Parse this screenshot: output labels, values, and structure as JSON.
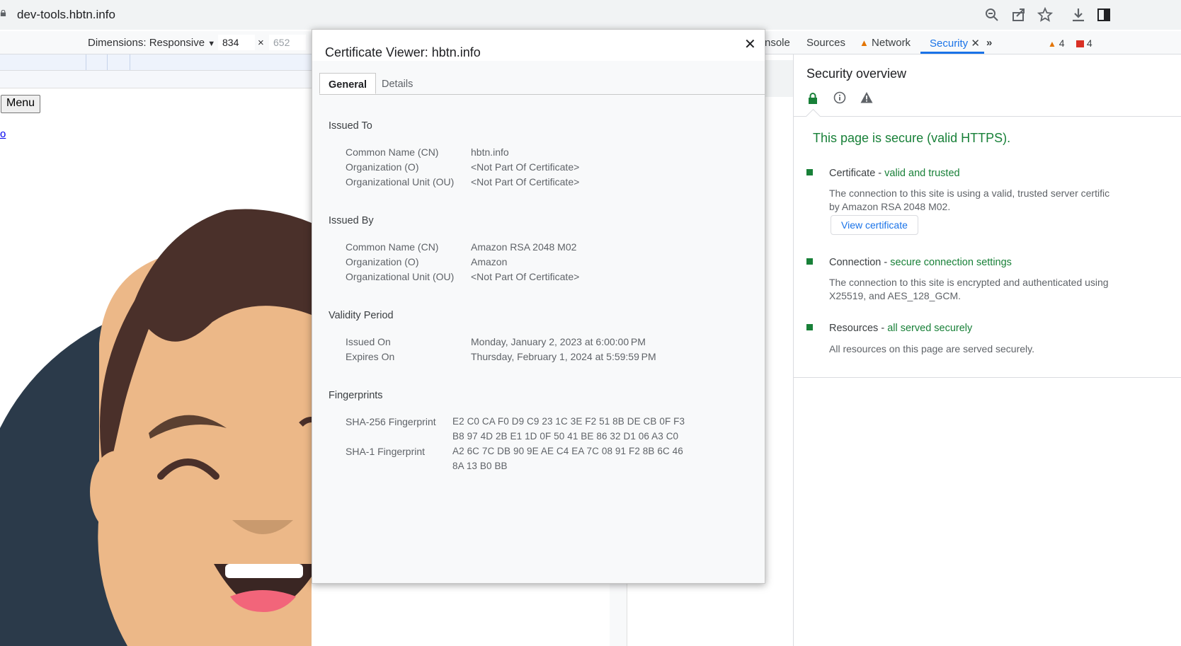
{
  "browser": {
    "url": "dev-tools.hbtn.info"
  },
  "device_toolbar": {
    "dimensions_label": "Dimensions: Responsive",
    "width": "834",
    "height": "652",
    "times": "×"
  },
  "page": {
    "menu_label": "Menu",
    "link_text": "o"
  },
  "devtools": {
    "tabs": [
      "nsole",
      "Sources",
      "Network",
      "Security"
    ],
    "more_glyph": "»",
    "warnings": "4",
    "errors": "4"
  },
  "security": {
    "title": "Security overview",
    "headline": "This page is secure (valid HTTPS).",
    "items": [
      {
        "title": "Certificate",
        "status": "valid and trusted",
        "desc_lines": [
          "The connection to this site is using a valid, trusted server certific",
          "by Amazon RSA 2048 M02."
        ],
        "button": "View certificate"
      },
      {
        "title": "Connection",
        "status": "secure connection settings",
        "desc_lines": [
          "The connection to this site is encrypted and authenticated using",
          "X25519, and AES_128_GCM."
        ]
      },
      {
        "title": "Resources",
        "status": "all served securely",
        "desc_lines": [
          "All resources on this page are served securely."
        ]
      }
    ],
    "separator": " - ",
    "colors": {
      "green": "#188038",
      "blue": "#1a73e8"
    }
  },
  "certificate": {
    "title": "Certificate Viewer: hbtn.info",
    "close_glyph": "✕",
    "tabs": [
      "General",
      "Details"
    ],
    "issued_to": {
      "label": "Issued To",
      "rows": [
        {
          "k": "Common Name (CN)",
          "v": "hbtn.info"
        },
        {
          "k": "Organization (O)",
          "v": "<Not Part Of Certificate>"
        },
        {
          "k": "Organizational Unit (OU)",
          "v": "<Not Part Of Certificate>"
        }
      ]
    },
    "issued_by": {
      "label": "Issued By",
      "rows": [
        {
          "k": "Common Name (CN)",
          "v": "Amazon RSA 2048 M02"
        },
        {
          "k": "Organization (O)",
          "v": "Amazon"
        },
        {
          "k": "Organizational Unit (OU)",
          "v": "<Not Part Of Certificate>"
        }
      ]
    },
    "validity": {
      "label": "Validity Period",
      "rows": [
        {
          "k": "Issued On",
          "v": "Monday, January 2, 2023 at 6:00:00 PM"
        },
        {
          "k": "Expires On",
          "v": "Thursday, February 1, 2024 at 5:59:59 PM"
        }
      ]
    },
    "fingerprints": {
      "label": "Fingerprints",
      "rows": [
        {
          "k": "SHA-256 Fingerprint",
          "lines": [
            "E2 C0 CA F0 D9 C9 23 1C 3E F2 51 8B DE CB 0F F3",
            "B8 97 4D 2B E1 1D 0F 50 41 BE 86 32 D1 06 A3 C0"
          ]
        },
        {
          "k": "SHA-1 Fingerprint",
          "lines": [
            "A2 6C 7C DB 90 9E AE C4 EA 7C 08 91 F2 8B 6C 46",
            "8A 13 B0 BB"
          ]
        }
      ]
    }
  }
}
